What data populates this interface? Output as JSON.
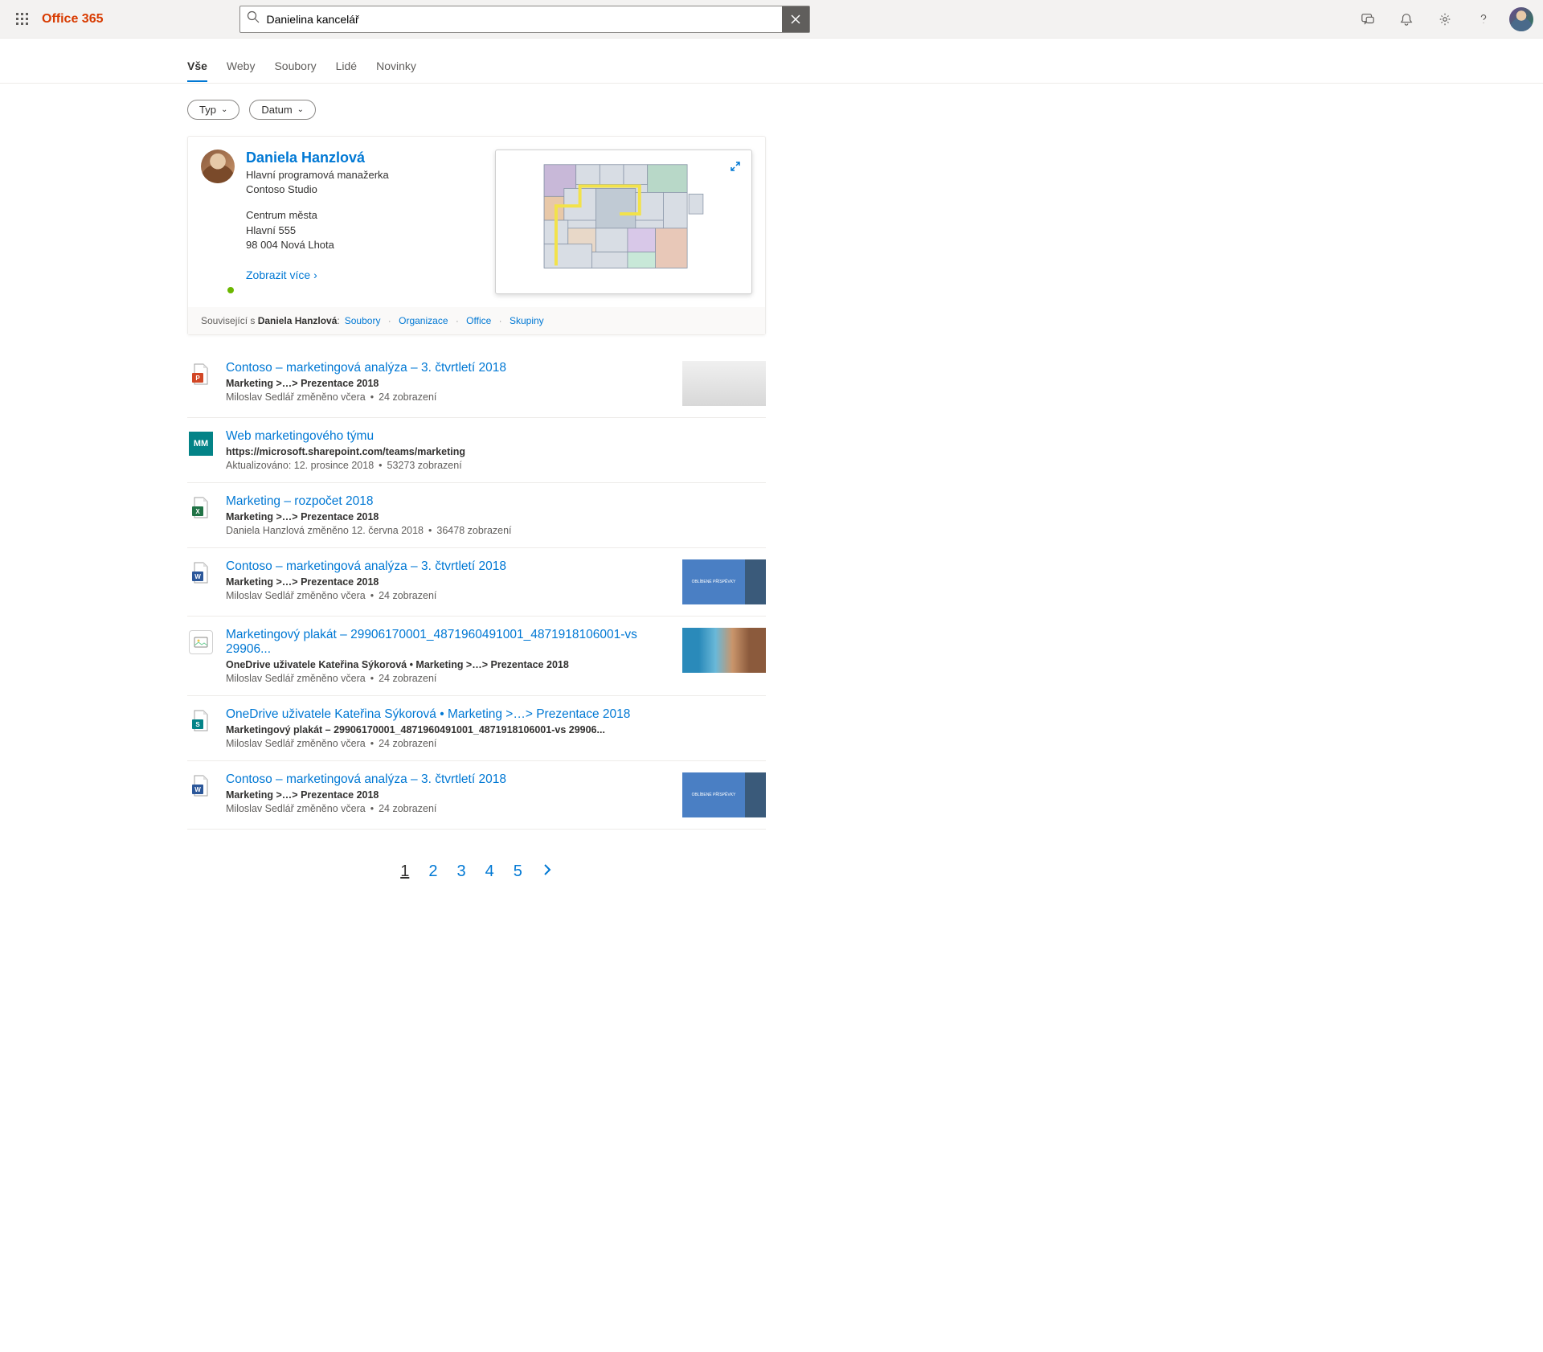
{
  "header": {
    "brand": "Office 365"
  },
  "search": {
    "value": "Danielina kancelář"
  },
  "tabs": [
    "Vše",
    "Weby",
    "Soubory",
    "Lidé",
    "Novinky"
  ],
  "filters": {
    "type": "Typ",
    "date": "Datum"
  },
  "person": {
    "name": "Daniela Hanzlová",
    "title": "Hlavní programová manažerka",
    "company": "Contoso Studio",
    "addr1": "Centrum města",
    "addr2": "Hlavní 555",
    "addr3": "98 004 Nová Lhota",
    "showMore": "Zobrazit více"
  },
  "related": {
    "prefix": "Související s ",
    "name": "Daniela Hanzlová",
    "links": [
      "Soubory",
      "Organizace",
      "Office",
      "Skupiny"
    ]
  },
  "results": [
    {
      "icon": "ppt",
      "title": "Contoso – marketingová analýza – 3. čtvrtletí 2018",
      "path": "Marketing >…> Prezentace 2018",
      "meta1": "Miloslav Sedlář",
      "meta2": "změněno včera",
      "meta3": "24 zobrazení",
      "thumb": "gray"
    },
    {
      "icon": "site",
      "title": "Web marketingového týmu",
      "path": "https://microsoft.sharepoint.com/teams/marketing",
      "meta1": "Aktualizováno: 12. prosince 2018",
      "meta2": "",
      "meta3": "53273 zobrazení",
      "thumb": ""
    },
    {
      "icon": "xls",
      "title": "Marketing – rozpočet 2018",
      "path": "Marketing >…> Prezentace 2018",
      "meta1": "Daniela Hanzlová",
      "meta2": "změněno 12. června 2018",
      "meta3": "36478 zobrazení",
      "thumb": ""
    },
    {
      "icon": "doc",
      "title": "Contoso – marketingová analýza – 3. čtvrtletí 2018",
      "path": "Marketing >…> Prezentace 2018",
      "meta1": "Miloslav Sedlář",
      "meta2": "změněno včera",
      "meta3": "24 zobrazení",
      "thumb": "blue"
    },
    {
      "icon": "img",
      "title": "Marketingový plakát – 29906170001_4871960491001_4871918106001-vs 29906...",
      "path": "OneDrive uživatele Kateřina Sýkorová   •   Marketing >…> Prezentace 2018",
      "meta1": "Miloslav Sedlář",
      "meta2": "změněno včera",
      "meta3": "24 zobrazení",
      "thumb": "moana"
    },
    {
      "icon": "sway",
      "title": "OneDrive uživatele Kateřina Sýkorová   •   Marketing >…> Prezentace 2018",
      "path": "Marketingový plakát – 29906170001_4871960491001_4871918106001-vs 29906...",
      "meta1": "Miloslav Sedlář",
      "meta2": "změněno včera",
      "meta3": "24 zobrazení",
      "thumb": ""
    },
    {
      "icon": "doc",
      "title": "Contoso – marketingová analýza – 3. čtvrtletí 2018",
      "path": "Marketing >…> Prezentace 2018",
      "meta1": "Miloslav Sedlář",
      "meta2": "změněno včera",
      "meta3": "24 zobrazení",
      "thumb": "blue"
    }
  ],
  "thumbText": "OBLÍBENÉ PŘÍSPĚVKY",
  "siteInitials": "MM",
  "pages": [
    "1",
    "2",
    "3",
    "4",
    "5"
  ]
}
